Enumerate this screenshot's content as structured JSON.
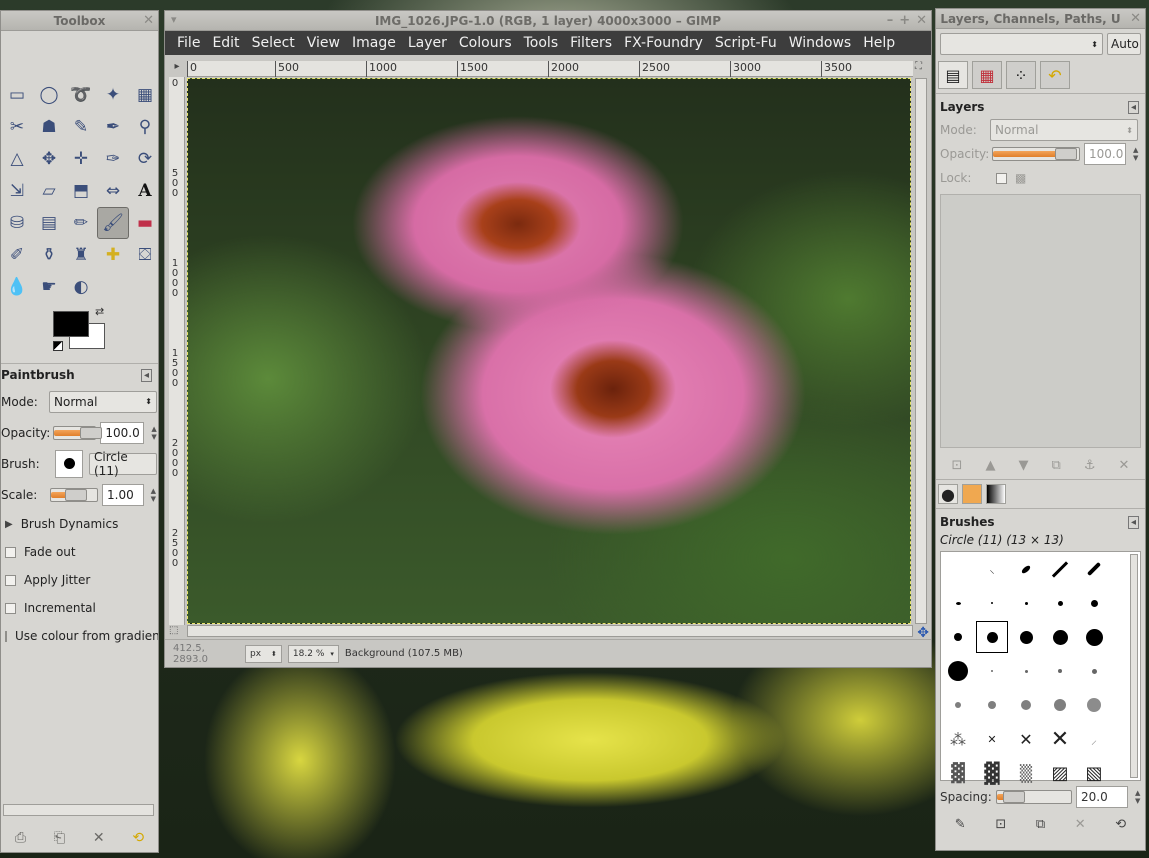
{
  "toolbox": {
    "title": "Toolbox",
    "tool_options": {
      "title": "Paintbrush",
      "mode_label": "Mode:",
      "mode_value": "Normal",
      "opacity_label": "Opacity:",
      "opacity_value": "100.0",
      "brush_label": "Brush:",
      "brush_value": "Circle (11)",
      "scale_label": "Scale:",
      "scale_value": "1.00",
      "dynamics_label": "Brush Dynamics",
      "checks": [
        "Fade out",
        "Apply Jitter",
        "Incremental",
        "Use colour from gradient"
      ]
    }
  },
  "image_window": {
    "title": "IMG_1026.JPG-1.0 (RGB, 1 layer) 4000x3000 – GIMP",
    "menu": [
      "File",
      "Edit",
      "Select",
      "View",
      "Image",
      "Layer",
      "Colours",
      "Tools",
      "Filters",
      "FX-Foundry",
      "Script-Fu",
      "Windows",
      "Help"
    ],
    "ruler_h": [
      "0",
      "500",
      "1000",
      "1500",
      "2000",
      "2500",
      "3000",
      "3500"
    ],
    "ruler_v": [
      "0",
      "500",
      "1000",
      "1500",
      "2000",
      "2500"
    ],
    "status": {
      "coords": "412.5, 2893.0",
      "unit": "px",
      "zoom": "18.2 %",
      "layer_info": "Background (107.5 MB)"
    }
  },
  "dock": {
    "title": "Layers, Channels, Paths, U",
    "auto_label": "Auto",
    "layers": {
      "title": "Layers",
      "mode_label": "Mode:",
      "mode_value": "Normal",
      "opacity_label": "Opacity:",
      "opacity_value": "100.0",
      "lock_label": "Lock:"
    },
    "brushes": {
      "title": "Brushes",
      "selected": "Circle (11) (13 × 13)",
      "spacing_label": "Spacing:",
      "spacing_value": "20.0"
    }
  }
}
